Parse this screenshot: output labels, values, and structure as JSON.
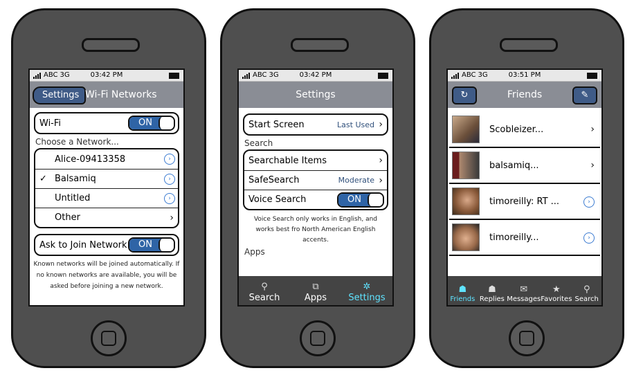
{
  "status": {
    "carrier": "ABC",
    "network": "3G",
    "times": [
      "03:42 PM",
      "03:42 PM",
      "03:51 PM"
    ]
  },
  "wifi": {
    "back_label": "Settings",
    "title": "Wi-Fi Networks",
    "wifi_label": "Wi-Fi",
    "wifi_toggle": "ON",
    "choose_label": "Choose a Network...",
    "networks": [
      {
        "name": "Alice-09413358",
        "checked": false,
        "accessory": "info"
      },
      {
        "name": "Balsamiq",
        "checked": true,
        "accessory": "info"
      },
      {
        "name": "Untitled",
        "checked": false,
        "accessory": "info"
      },
      {
        "name": "Other",
        "checked": false,
        "accessory": "chevron"
      }
    ],
    "ask_label": "Ask to Join Network",
    "ask_toggle": "ON",
    "footer": "Known networks will be joined automatically. If no known networks are available, you will be asked before joining a new network."
  },
  "settings": {
    "title": "Settings",
    "start_screen_label": "Start Screen",
    "start_screen_value": "Last Used",
    "search_section": "Search",
    "searchable_items_label": "Searchable Items",
    "safesearch_label": "SafeSearch",
    "safesearch_value": "Moderate",
    "voice_search_label": "Voice Search",
    "voice_search_toggle": "ON",
    "note": "Voice Search only works in English, and works best fro North American English accents.",
    "apps_section": "Apps",
    "tabs": [
      {
        "label": "Search",
        "icon": "magnifier-icon",
        "active": false
      },
      {
        "label": "Apps",
        "icon": "apps-icon",
        "active": false
      },
      {
        "label": "Settings",
        "icon": "gear-icon",
        "active": true
      }
    ]
  },
  "friends": {
    "title": "Friends",
    "items": [
      {
        "name": "Scobleizer...",
        "accessory": "chevron"
      },
      {
        "name": "balsamiq...",
        "accessory": "chevron"
      },
      {
        "name": "timoreilly: RT ...",
        "accessory": "info"
      },
      {
        "name": "timoreilly...",
        "accessory": "info"
      }
    ],
    "tabs": [
      {
        "label": "Friends",
        "icon": "friends-icon",
        "active": true
      },
      {
        "label": "Replies",
        "icon": "replies-icon",
        "active": false
      },
      {
        "label": "Messages",
        "icon": "envelope-icon",
        "active": false
      },
      {
        "label": "Favorites",
        "icon": "star-icon",
        "active": false
      },
      {
        "label": "Search",
        "icon": "magnifier-icon",
        "active": false
      }
    ]
  },
  "colors": {
    "phone_body": "#4f4f4f",
    "nav_bar": "#8a8d95",
    "button_blue": "#3f5b87",
    "toggle_blue": "#2f64a6",
    "tab_active": "#5fe3ff"
  }
}
